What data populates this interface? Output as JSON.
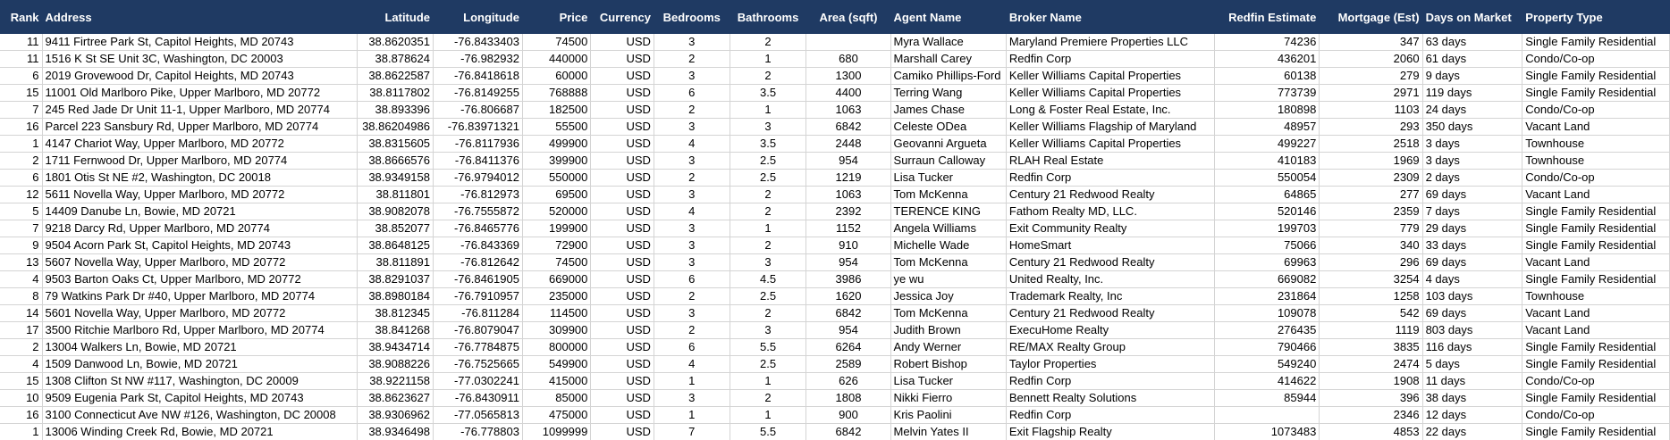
{
  "columns": [
    {
      "key": "rank",
      "label": "Rank",
      "align": "r"
    },
    {
      "key": "address",
      "label": "Address",
      "align": "l"
    },
    {
      "key": "latitude",
      "label": "Latitude",
      "align": "r"
    },
    {
      "key": "longitude",
      "label": "Longitude",
      "align": "r"
    },
    {
      "key": "price",
      "label": "Price",
      "align": "r"
    },
    {
      "key": "currency",
      "label": "Currency",
      "align": "r"
    },
    {
      "key": "bedrooms",
      "label": "Bedrooms",
      "align": "c"
    },
    {
      "key": "bathrooms",
      "label": "Bathrooms",
      "align": "c"
    },
    {
      "key": "area",
      "label": "Area (sqft)",
      "align": "c"
    },
    {
      "key": "agent",
      "label": "Agent Name",
      "align": "l"
    },
    {
      "key": "broker",
      "label": "Broker Name",
      "align": "l"
    },
    {
      "key": "estimate",
      "label": "Redfin Estimate",
      "align": "r"
    },
    {
      "key": "mortgage",
      "label": "Mortgage (Est)",
      "align": "r"
    },
    {
      "key": "days",
      "label": "Days on Market",
      "align": "l"
    },
    {
      "key": "type",
      "label": "Property Type",
      "align": "l"
    }
  ],
  "rows": [
    [
      "11",
      "9411 Firtree Park St, Capitol Heights, MD 20743",
      "38.8620351",
      "-76.8433403",
      "74500",
      "USD",
      "3",
      "2",
      "",
      "Myra Wallace",
      "Maryland Premiere Properties LLC",
      "74236",
      "347",
      "63 days",
      "Single Family Residential"
    ],
    [
      "11",
      "1516 K St SE Unit 3C, Washington, DC 20003",
      "38.878624",
      "-76.982932",
      "440000",
      "USD",
      "2",
      "1",
      "680",
      "Marshall Carey",
      "Redfin Corp",
      "436201",
      "2060",
      "61 days",
      "Condo/Co-op"
    ],
    [
      "6",
      "2019 Grovewood Dr, Capitol Heights, MD 20743",
      "38.8622587",
      "-76.8418618",
      "60000",
      "USD",
      "3",
      "2",
      "1300",
      "Camiko Phillips-Ford",
      "Keller Williams Capital Properties",
      "60138",
      "279",
      "9 days",
      "Single Family Residential"
    ],
    [
      "15",
      "11001 Old Marlboro Pike, Upper Marlboro, MD 20772",
      "38.8117802",
      "-76.8149255",
      "768888",
      "USD",
      "6",
      "3.5",
      "4400",
      "Terring Wang",
      "Keller Williams Capital Properties",
      "773739",
      "2971",
      "119 days",
      "Single Family Residential"
    ],
    [
      "7",
      "245 Red Jade Dr Unit 11-1, Upper Marlboro, MD 20774",
      "38.893396",
      "-76.806687",
      "182500",
      "USD",
      "2",
      "1",
      "1063",
      "James Chase",
      "Long & Foster Real Estate, Inc.",
      "180898",
      "1103",
      "24 days",
      "Condo/Co-op"
    ],
    [
      "16",
      "Parcel 223 Sansbury Rd, Upper Marlboro, MD 20774",
      "38.86204986",
      "-76.83971321",
      "55500",
      "USD",
      "3",
      "3",
      "6842",
      "Celeste ODea",
      "Keller Williams Flagship of Maryland",
      "48957",
      "293",
      "350 days",
      "Vacant Land"
    ],
    [
      "1",
      "4147 Chariot Way, Upper Marlboro, MD 20772",
      "38.8315605",
      "-76.8117936",
      "499900",
      "USD",
      "4",
      "3.5",
      "2448",
      "Geovanni Argueta",
      "Keller Williams Capital Properties",
      "499227",
      "2518",
      "3 days",
      "Townhouse"
    ],
    [
      "2",
      "1711 Fernwood Dr, Upper Marlboro, MD 20774",
      "38.8666576",
      "-76.8411376",
      "399900",
      "USD",
      "3",
      "2.5",
      "954",
      "Surraun Calloway",
      "RLAH Real Estate",
      "410183",
      "1969",
      "3 days",
      "Townhouse"
    ],
    [
      "6",
      "1801 Otis St NE #2, Washington, DC 20018",
      "38.9349158",
      "-76.9794012",
      "550000",
      "USD",
      "2",
      "2.5",
      "1219",
      "Lisa Tucker",
      "Redfin Corp",
      "550054",
      "2309",
      "2 days",
      "Condo/Co-op"
    ],
    [
      "12",
      "5611 Novella Way, Upper Marlboro, MD 20772",
      "38.811801",
      "-76.812973",
      "69500",
      "USD",
      "3",
      "2",
      "1063",
      "Tom McKenna",
      "Century 21 Redwood Realty",
      "64865",
      "277",
      "69 days",
      "Vacant Land"
    ],
    [
      "5",
      "14409 Danube Ln, Bowie, MD 20721",
      "38.9082078",
      "-76.7555872",
      "520000",
      "USD",
      "4",
      "2",
      "2392",
      "TERENCE KING",
      "Fathom Realty MD, LLC.",
      "520146",
      "2359",
      "7 days",
      "Single Family Residential"
    ],
    [
      "7",
      "9218 Darcy Rd, Upper Marlboro, MD 20774",
      "38.852077",
      "-76.8465776",
      "199900",
      "USD",
      "3",
      "1",
      "1152",
      "Angela Williams",
      "Exit Community Realty",
      "199703",
      "779",
      "29 days",
      "Single Family Residential"
    ],
    [
      "9",
      "9504 Acorn Park St, Capitol Heights, MD 20743",
      "38.8648125",
      "-76.843369",
      "72900",
      "USD",
      "3",
      "2",
      "910",
      "Michelle Wade",
      "HomeSmart",
      "75066",
      "340",
      "33 days",
      "Single Family Residential"
    ],
    [
      "13",
      "5607 Novella Way, Upper Marlboro, MD 20772",
      "38.811891",
      "-76.812642",
      "74500",
      "USD",
      "3",
      "3",
      "954",
      "Tom McKenna",
      "Century 21 Redwood Realty",
      "69963",
      "296",
      "69 days",
      "Vacant Land"
    ],
    [
      "4",
      "9503 Barton Oaks Ct, Upper Marlboro, MD 20772",
      "38.8291037",
      "-76.8461905",
      "669000",
      "USD",
      "6",
      "4.5",
      "3986",
      "ye wu",
      "United Realty, Inc.",
      "669082",
      "3254",
      "4 days",
      "Single Family Residential"
    ],
    [
      "8",
      "79 Watkins Park Dr #40, Upper Marlboro, MD 20774",
      "38.8980184",
      "-76.7910957",
      "235000",
      "USD",
      "2",
      "2.5",
      "1620",
      "Jessica Joy",
      "Trademark Realty, Inc",
      "231864",
      "1258",
      "103 days",
      "Townhouse"
    ],
    [
      "14",
      "5601 Novella Way, Upper Marlboro, MD 20772",
      "38.812345",
      "-76.811284",
      "114500",
      "USD",
      "3",
      "2",
      "6842",
      "Tom McKenna",
      "Century 21 Redwood Realty",
      "109078",
      "542",
      "69 days",
      "Vacant Land"
    ],
    [
      "17",
      "3500 Ritchie Marlboro Rd, Upper Marlboro, MD 20774",
      "38.841268",
      "-76.8079047",
      "309900",
      "USD",
      "2",
      "3",
      "954",
      "Judith Brown",
      "ExecuHome Realty",
      "276435",
      "1119",
      "803 days",
      "Vacant Land"
    ],
    [
      "2",
      "13004 Walkers Ln, Bowie, MD 20721",
      "38.9434714",
      "-76.7784875",
      "800000",
      "USD",
      "6",
      "5.5",
      "6264",
      "Andy Werner",
      "RE/MAX Realty Group",
      "790466",
      "3835",
      "116 days",
      "Single Family Residential"
    ],
    [
      "4",
      "1509 Danwood Ln, Bowie, MD 20721",
      "38.9088226",
      "-76.7525665",
      "549900",
      "USD",
      "4",
      "2.5",
      "2589",
      "Robert Bishop",
      "Taylor Properties",
      "549240",
      "2474",
      "5 days",
      "Single Family Residential"
    ],
    [
      "15",
      "1308 Clifton St NW #117, Washington, DC 20009",
      "38.9221158",
      "-77.0302241",
      "415000",
      "USD",
      "1",
      "1",
      "626",
      "Lisa Tucker",
      "Redfin Corp",
      "414622",
      "1908",
      "11 days",
      "Condo/Co-op"
    ],
    [
      "10",
      "9509 Eugenia Park St, Capitol Heights, MD 20743",
      "38.8623627",
      "-76.8430911",
      "85000",
      "USD",
      "3",
      "2",
      "1808",
      "Nikki Fierro",
      "Bennett Realty Solutions",
      "85944",
      "396",
      "38 days",
      "Single Family Residential"
    ],
    [
      "16",
      "3100 Connecticut Ave NW #126, Washington, DC 20008",
      "38.9306962",
      "-77.0565813",
      "475000",
      "USD",
      "1",
      "1",
      "900",
      "Kris Paolini",
      "Redfin Corp",
      "",
      "2346",
      "12 days",
      "Condo/Co-op"
    ],
    [
      "1",
      "13006 Winding Creek Rd, Bowie, MD 20721",
      "38.9346498",
      "-76.778803",
      "1099999",
      "USD",
      "7",
      "5.5",
      "6842",
      "Melvin Yates II",
      "Exit Flagship Realty",
      "1073483",
      "4853",
      "22 days",
      "Single Family Residential"
    ]
  ]
}
